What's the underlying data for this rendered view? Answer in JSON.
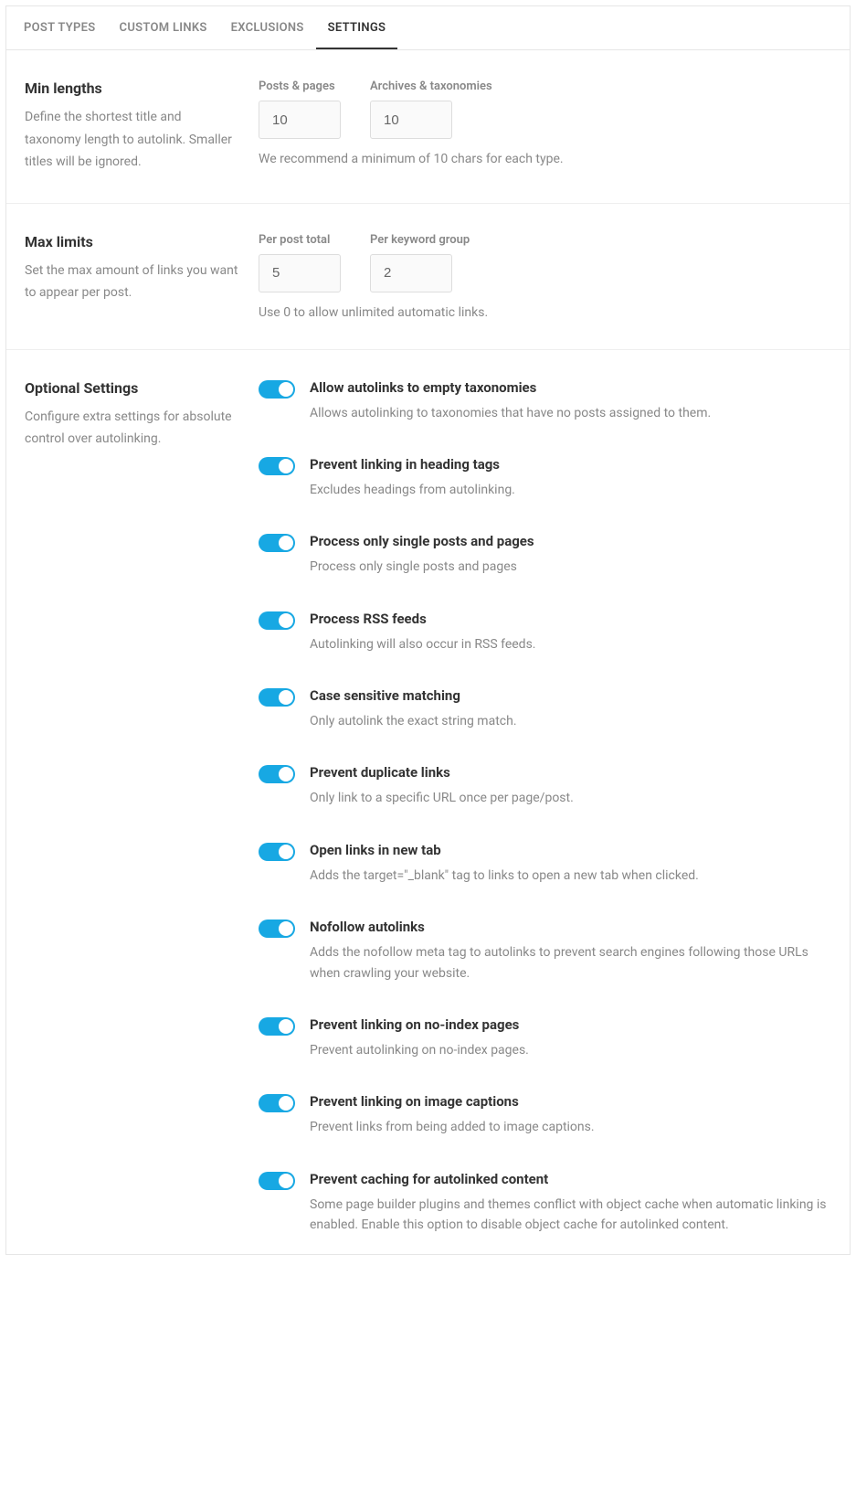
{
  "tabs": [
    {
      "label": "POST TYPES",
      "active": false
    },
    {
      "label": "CUSTOM LINKS",
      "active": false
    },
    {
      "label": "EXCLUSIONS",
      "active": false
    },
    {
      "label": "SETTINGS",
      "active": true
    }
  ],
  "sections": {
    "minLengths": {
      "title": "Min lengths",
      "desc": "Define the shortest title and taxonomy length to autolink. Smaller titles will be ignored.",
      "fields": [
        {
          "label": "Posts & pages",
          "value": "10"
        },
        {
          "label": "Archives & taxonomies",
          "value": "10"
        }
      ],
      "hint": "We recommend a minimum of 10 chars for each type."
    },
    "maxLimits": {
      "title": "Max limits",
      "desc": "Set the max amount of links you want to appear per post.",
      "fields": [
        {
          "label": "Per post total",
          "value": "5"
        },
        {
          "label": "Per keyword group",
          "value": "2"
        }
      ],
      "hint": "Use 0 to allow unlimited automatic links."
    },
    "optional": {
      "title": "Optional Settings",
      "desc": "Configure extra settings for absolute control over autolinking.",
      "toggles": [
        {
          "title": "Allow autolinks to empty taxonomies",
          "desc": "Allows autolinking to taxonomies that have no posts assigned to them."
        },
        {
          "title": "Prevent linking in heading tags",
          "desc": "Excludes headings from autolinking."
        },
        {
          "title": "Process only single posts and pages",
          "desc": "Process only single posts and pages"
        },
        {
          "title": "Process RSS feeds",
          "desc": "Autolinking will also occur in RSS feeds."
        },
        {
          "title": "Case sensitive matching",
          "desc": "Only autolink the exact string match."
        },
        {
          "title": "Prevent duplicate links",
          "desc": "Only link to a specific URL once per page/post."
        },
        {
          "title": "Open links in new tab",
          "desc": "Adds the target=\"_blank\" tag to links to open a new tab when clicked."
        },
        {
          "title": "Nofollow autolinks",
          "desc": "Adds the nofollow meta tag to autolinks to prevent search engines following those URLs when crawling your website."
        },
        {
          "title": "Prevent linking on no-index pages",
          "desc": "Prevent autolinking on no-index pages."
        },
        {
          "title": "Prevent linking on image captions",
          "desc": "Prevent links from being added to image captions."
        },
        {
          "title": "Prevent caching for autolinked content",
          "desc": "Some page builder plugins and themes conflict with object cache when automatic linking is enabled. Enable this option to disable object cache for autolinked content."
        }
      ]
    }
  }
}
